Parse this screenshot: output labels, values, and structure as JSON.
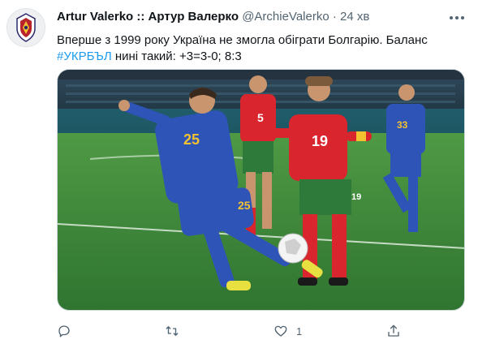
{
  "tweet": {
    "author_name": "Artur Valerko :: Артур Валерко",
    "author_handle": "@ArchieValerko",
    "separator": "·",
    "time": "24 хв",
    "text_line1": "Вперше з 1999 року Україна не змогла обіграти Болгарію. Баланс",
    "hashtag": "#УКРБЪЛ",
    "text_line2_rest": " нині такий: +3=3-0; 8:3",
    "avatar_icon": "club-crest-icon",
    "photo_icon": "football-match-photo",
    "colors": {
      "hashtag": "#1d9bf0",
      "ukraine_kit": "#2f54b8",
      "bulgaria_kit": "#d8252e",
      "pitch": "#3f8a3a"
    }
  },
  "actions": {
    "reply_icon": "reply-icon",
    "retweet_icon": "retweet-icon",
    "like_icon": "heart-icon",
    "like_count": "1",
    "share_icon": "share-icon"
  }
}
